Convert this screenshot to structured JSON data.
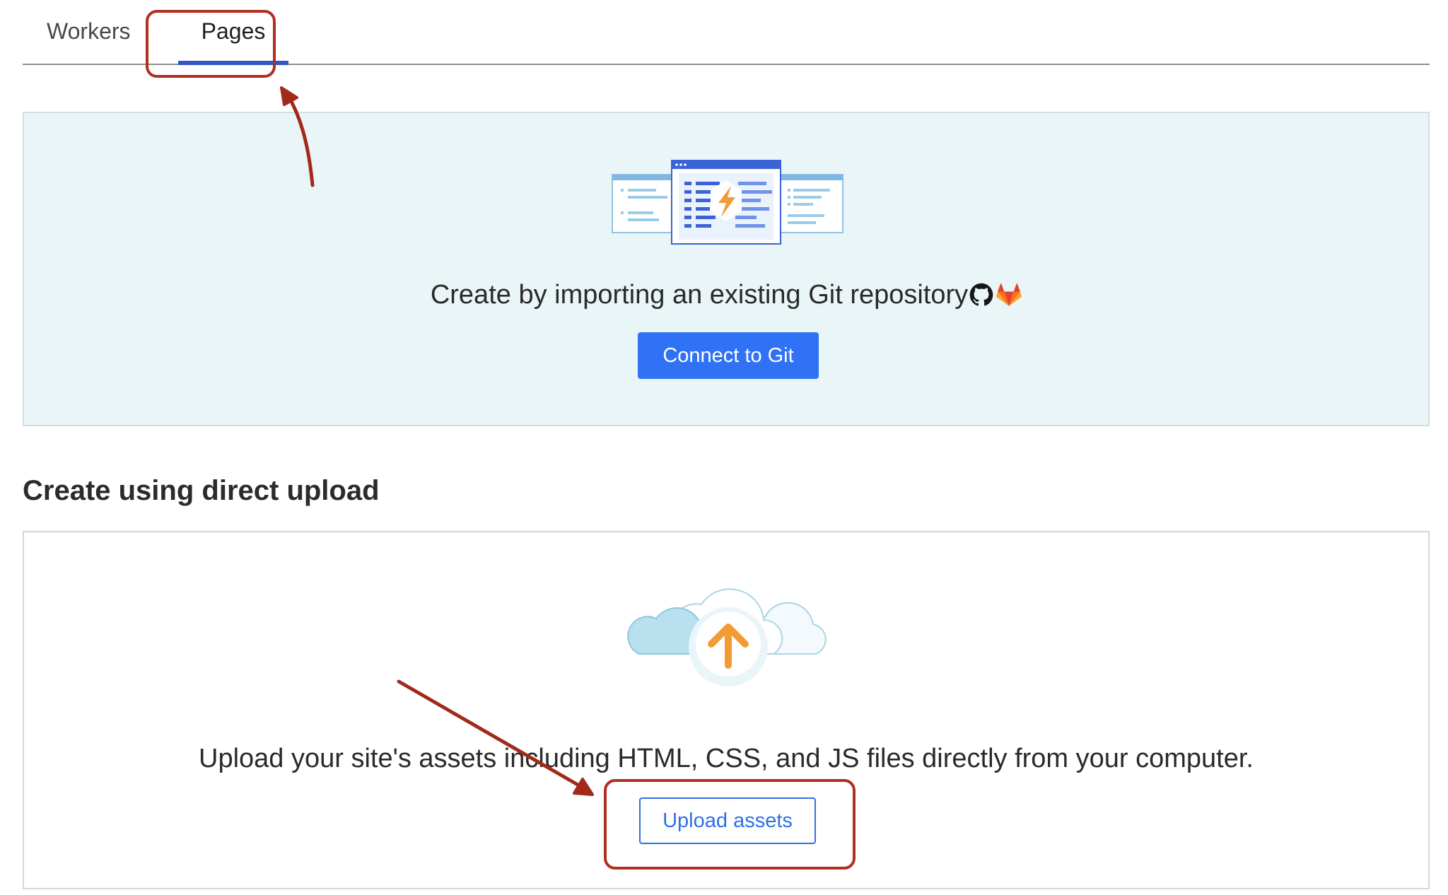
{
  "tabs": {
    "workers": "Workers",
    "pages": "Pages"
  },
  "git_card": {
    "text": "Create by importing an existing Git repository",
    "button": "Connect to Git"
  },
  "upload_section": {
    "heading": "Create using direct upload",
    "text": "Upload your site's assets including HTML, CSS, and JS files directly from your computer.",
    "button": "Upload assets"
  },
  "colors": {
    "accent": "#2f72f6",
    "annotation": "#b12f20",
    "card_background": "#eaf5f8"
  },
  "icons": [
    "pages-browser-illustration",
    "github-icon",
    "gitlab-icon",
    "cloud-upload-illustration"
  ]
}
